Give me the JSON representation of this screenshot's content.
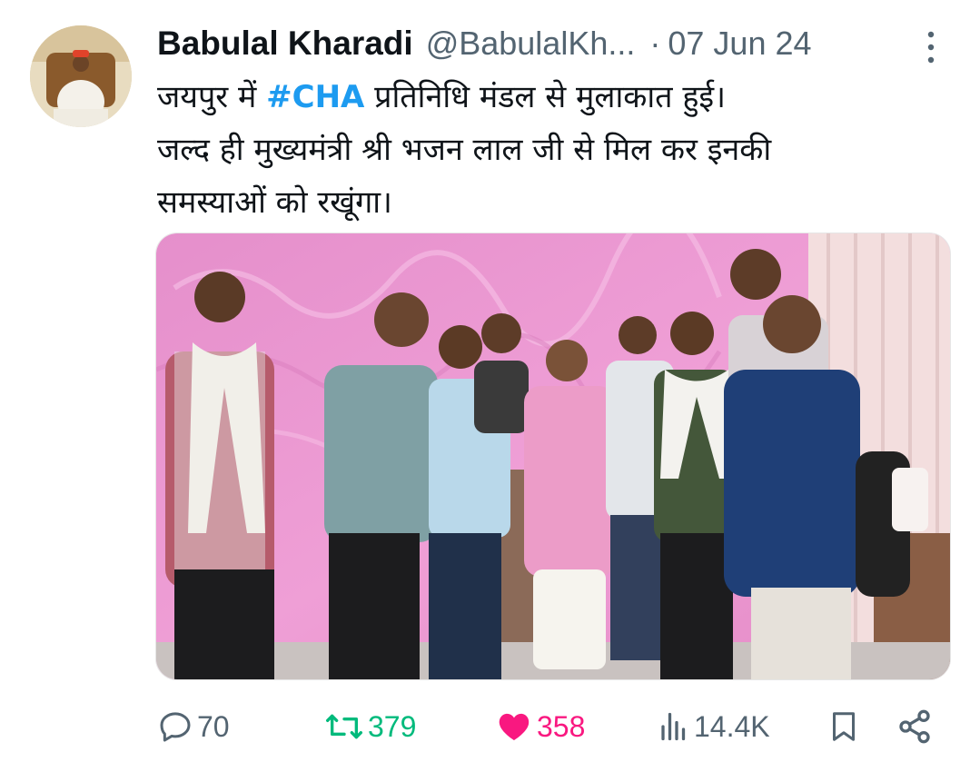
{
  "author": {
    "display_name": "Babulal Kharadi",
    "handle": "@BabulalKh...",
    "separator": "·",
    "date": "07 Jun 24"
  },
  "tweet": {
    "line1_before": "जयपुर में ",
    "hashtag": "#CHA",
    "line1_after": " प्रतिनिधि मंडल से मुलाकात हुई।",
    "line2": "जल्द ही मुख्यमंत्री श्री भजन लाल जी से मिल कर इनकी",
    "line3": "समस्याओं को रखूंगा।"
  },
  "actions": {
    "replies": "70",
    "retweets": "379",
    "likes": "358",
    "views": "14.4K"
  },
  "icons": {
    "more": "more-vertical-icon",
    "reply": "reply-icon",
    "retweet": "retweet-icon",
    "like": "heart-icon",
    "views": "views-icon",
    "bookmark": "bookmark-icon",
    "share": "share-icon"
  },
  "colors": {
    "hashtag": "#1d9bf0",
    "secondary_text": "#536471",
    "retweet_active": "#00ba7c",
    "like_active": "#f91880",
    "wall_pink": "#e99ad0"
  }
}
